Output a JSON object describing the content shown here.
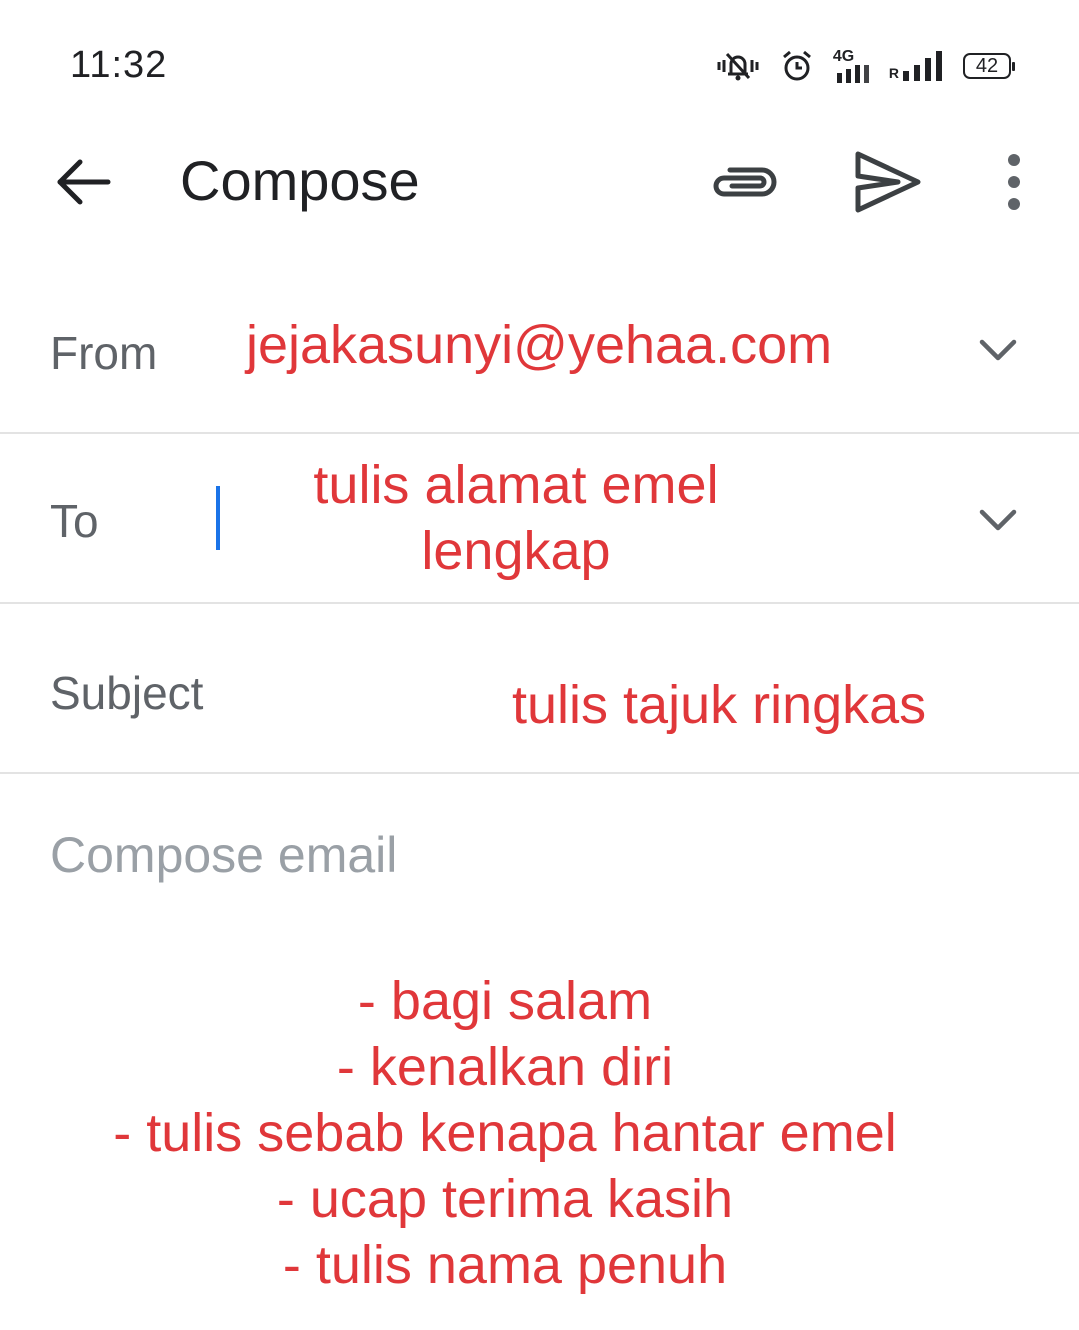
{
  "status_bar": {
    "time": "11:32",
    "network_type": "4G",
    "roaming": "R",
    "battery": "42",
    "icons": [
      "vibrate-mute-icon",
      "alarm-icon",
      "mobile-data-icon",
      "signal-icon",
      "battery-icon"
    ]
  },
  "app_bar": {
    "title": "Compose",
    "icons": [
      "back-arrow-icon",
      "attach-icon",
      "send-icon",
      "more-vert-icon"
    ]
  },
  "fields": {
    "from": {
      "label": "From",
      "value": "jejakasunyi@yehaa.com"
    },
    "to": {
      "label": "To",
      "value": "",
      "annotation_line1": "tulis alamat emel",
      "annotation_line2": "lengkap"
    },
    "subject": {
      "label": "Subject",
      "value": "",
      "annotation": "tulis tajuk ringkas"
    }
  },
  "body": {
    "placeholder": "Compose email",
    "annotation_lines": [
      "- bagi salam",
      "- kenalkan diri",
      "- tulis sebab kenapa hantar emel",
      "- ucap terima kasih",
      "- tulis nama penuh"
    ]
  },
  "colors": {
    "annotation": "#e0373a",
    "caret": "#1a73e8",
    "label": "#5f6368",
    "placeholder": "#9aa0a6",
    "divider": "#e3e3e3"
  }
}
